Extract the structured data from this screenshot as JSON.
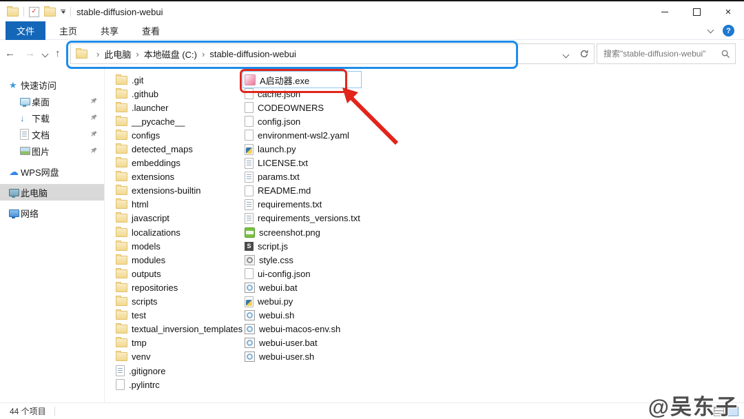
{
  "window": {
    "title": "stable-diffusion-webui",
    "close_glyph": "×"
  },
  "ribbon": {
    "tabs": [
      {
        "label": "文件",
        "active": true
      },
      {
        "label": "主页",
        "active": false
      },
      {
        "label": "共享",
        "active": false
      },
      {
        "label": "查看",
        "active": false
      }
    ]
  },
  "navbar": {
    "breadcrumbs": [
      "此电脑",
      "本地磁盘 (C:)",
      "stable-diffusion-webui"
    ],
    "crumb_separator": "›",
    "back_glyph": "←",
    "forward_glyph": "→",
    "up_glyph": "↑",
    "search_placeholder": "搜索\"stable-diffusion-webui\""
  },
  "sidebar": {
    "items": [
      {
        "label": "快速访问",
        "icon": "star-icon",
        "pinned": false,
        "selected": false
      },
      {
        "label": "桌面",
        "icon": "desktop-icon",
        "pinned": true,
        "selected": false
      },
      {
        "label": "下载",
        "icon": "download-icon",
        "pinned": true,
        "selected": false
      },
      {
        "label": "文档",
        "icon": "document-icon",
        "pinned": true,
        "selected": false
      },
      {
        "label": "图片",
        "icon": "pictures-icon",
        "pinned": true,
        "selected": false
      },
      {
        "label": "WPS网盘",
        "icon": "cloud-icon",
        "pinned": false,
        "selected": false
      },
      {
        "label": "此电脑",
        "icon": "computer-icon",
        "pinned": false,
        "selected": true
      },
      {
        "label": "网络",
        "icon": "network-icon",
        "pinned": false,
        "selected": false
      }
    ]
  },
  "files": {
    "left": [
      {
        "name": ".git",
        "icon": "folder"
      },
      {
        "name": ".github",
        "icon": "folder"
      },
      {
        "name": ".launcher",
        "icon": "folder"
      },
      {
        "name": "__pycache__",
        "icon": "folder"
      },
      {
        "name": "configs",
        "icon": "folder"
      },
      {
        "name": "detected_maps",
        "icon": "folder"
      },
      {
        "name": "embeddings",
        "icon": "folder"
      },
      {
        "name": "extensions",
        "icon": "folder"
      },
      {
        "name": "extensions-builtin",
        "icon": "folder"
      },
      {
        "name": "html",
        "icon": "folder"
      },
      {
        "name": "javascript",
        "icon": "folder"
      },
      {
        "name": "localizations",
        "icon": "folder"
      },
      {
        "name": "models",
        "icon": "folder"
      },
      {
        "name": "modules",
        "icon": "folder"
      },
      {
        "name": "outputs",
        "icon": "folder"
      },
      {
        "name": "repositories",
        "icon": "folder"
      },
      {
        "name": "scripts",
        "icon": "folder"
      },
      {
        "name": "test",
        "icon": "folder"
      },
      {
        "name": "textual_inversion_templates",
        "icon": "folder"
      },
      {
        "name": "tmp",
        "icon": "folder"
      },
      {
        "name": "venv",
        "icon": "folder"
      },
      {
        "name": ".gitignore",
        "icon": "text-file"
      },
      {
        "name": ".pylintrc",
        "icon": "file"
      }
    ],
    "right": [
      {
        "name": "A启动器.exe",
        "icon": "exe-file",
        "highlighted": true
      },
      {
        "name": "cache.json",
        "icon": "file"
      },
      {
        "name": "CODEOWNERS",
        "icon": "file"
      },
      {
        "name": "config.json",
        "icon": "file"
      },
      {
        "name": "environment-wsl2.yaml",
        "icon": "file"
      },
      {
        "name": "launch.py",
        "icon": "python-file"
      },
      {
        "name": "LICENSE.txt",
        "icon": "text-file"
      },
      {
        "name": "params.txt",
        "icon": "text-file"
      },
      {
        "name": "README.md",
        "icon": "file"
      },
      {
        "name": "requirements.txt",
        "icon": "text-file"
      },
      {
        "name": "requirements_versions.txt",
        "icon": "text-file"
      },
      {
        "name": "screenshot.png",
        "icon": "png-file"
      },
      {
        "name": "script.js",
        "icon": "js-file"
      },
      {
        "name": "style.css",
        "icon": "css-file"
      },
      {
        "name": "ui-config.json",
        "icon": "file"
      },
      {
        "name": "webui.bat",
        "icon": "script-file"
      },
      {
        "name": "webui.py",
        "icon": "python-file"
      },
      {
        "name": "webui.sh",
        "icon": "script-file"
      },
      {
        "name": "webui-macos-env.sh",
        "icon": "script-file"
      },
      {
        "name": "webui-user.bat",
        "icon": "script-file"
      },
      {
        "name": "webui-user.sh",
        "icon": "script-file"
      }
    ]
  },
  "statusbar": {
    "count": "44 个项目"
  },
  "watermark": "@吴东子",
  "annotations": {
    "highlight_blue": "#1d8ceb",
    "highlight_red": "#e1251b"
  }
}
